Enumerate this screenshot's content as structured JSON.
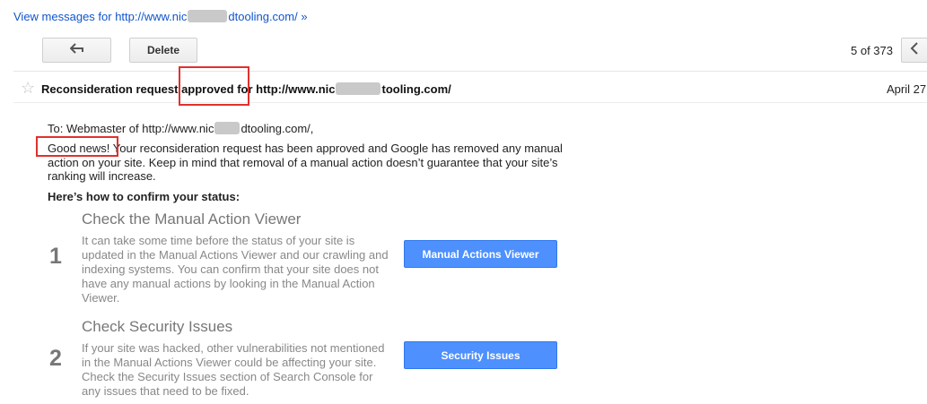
{
  "header": {
    "view_link": "View messages for http://www.nic",
    "view_link_suffix": "dtooling.com/ »"
  },
  "toolbar": {
    "back_icon": "reply-arrow-icon",
    "delete_label": "Delete",
    "pagination": "5 of 373",
    "prev_icon": "chevron-left-icon"
  },
  "message": {
    "subject_pre": "Reconsideration request",
    "subject_highlight": "approved",
    "subject_mid": "for http://www.nic",
    "subject_post": "tooling.com/",
    "date": "April 27",
    "star_icon": "star-icon"
  },
  "body": {
    "to_pre": "To: Webmaster of http://www.nic",
    "to_post": "dtooling.com/,",
    "good_news": "Good news!",
    "para_rest": " Your reconsideration request has been approved and Google has removed any manual action on your site. Keep in mind that removal of a manual action doesn’t guarantee that your site’s ranking will increase.",
    "howto": "Here’s how to confirm your status:",
    "steps": [
      {
        "number": "1",
        "title": "Check the Manual Action Viewer",
        "text": "It can take some time before the status of your site is updated in the Manual Actions Viewer and our crawling and indexing systems. You can confirm that your site does not have any manual actions by looking in the Manual Action Viewer.",
        "button": "Manual Actions Viewer"
      },
      {
        "number": "2",
        "title": "Check Security Issues",
        "text": "If your site was hacked, other vulnerabilities not mentioned in the Manual Actions Viewer could be affecting your site. Check the Security Issues section of Search Console for any issues that need to be fixed.",
        "button": "Security Issues"
      }
    ]
  },
  "colors": {
    "link": "#1155cc",
    "button_blue": "#4d90fe",
    "highlight_red": "#e0312e"
  }
}
